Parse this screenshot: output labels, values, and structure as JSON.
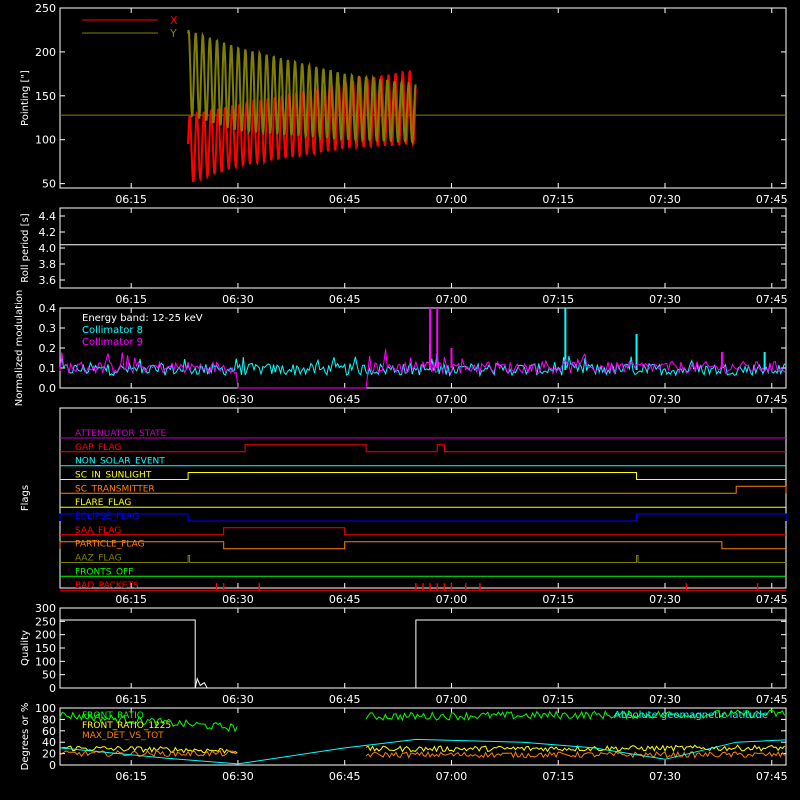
{
  "colors": {
    "background": "#000000",
    "axis": "#ffffff",
    "red": "#ff0000",
    "olive": "#808000",
    "cyan": "#00ffff",
    "magenta": "#ff00ff",
    "green": "#00ff00",
    "orange": "#ff8000",
    "yellow": "#ffff00",
    "blue": "#0000ff",
    "purple": "#c000c0"
  },
  "chart_data": [
    {
      "type": "line",
      "ylabel": "Pointing [\"]",
      "xlim": [
        "06:05",
        "07:47"
      ],
      "ylim": [
        45,
        250
      ],
      "x_ticks": [
        "06:15",
        "06:30",
        "06:45",
        "07:00",
        "07:15",
        "07:30",
        "07:45"
      ],
      "y_ticks": [
        50,
        100,
        150,
        200,
        250
      ],
      "reference_line": 128,
      "legend": [
        "X",
        "Y"
      ],
      "series": [
        {
          "name": "X",
          "color": "#ff0000",
          "envelope": [
            {
              "t": "06:23",
              "min": 50,
              "max": 128
            },
            {
              "t": "06:30",
              "min": 70,
              "max": 140
            },
            {
              "t": "06:45",
              "min": 90,
              "max": 165
            },
            {
              "t": "06:55",
              "min": 95,
              "max": 180
            }
          ]
        },
        {
          "name": "Y",
          "color": "#808000",
          "envelope": [
            {
              "t": "06:23",
              "min": 128,
              "max": 225
            },
            {
              "t": "06:30",
              "min": 110,
              "max": 205
            },
            {
              "t": "06:45",
              "min": 100,
              "max": 175
            },
            {
              "t": "06:55",
              "min": 97,
              "max": 163
            }
          ]
        }
      ]
    },
    {
      "type": "line",
      "ylabel": "Roll period [s]",
      "xlim": [
        "06:05",
        "07:47"
      ],
      "ylim": [
        3.5,
        4.5
      ],
      "x_ticks": [
        "06:15",
        "06:30",
        "06:45",
        "07:00",
        "07:15",
        "07:30",
        "07:45"
      ],
      "y_ticks": [
        "3.6",
        "3.8",
        "4.0",
        "4.2",
        "4.4"
      ],
      "series": [
        {
          "name": "",
          "color": "#ffffff",
          "x": [
            "06:05",
            "07:47"
          ],
          "y": [
            4.04,
            4.04
          ]
        }
      ]
    },
    {
      "type": "line",
      "ylabel": "Normalized modulation",
      "ylim": [
        0,
        0.4
      ],
      "y_ticks": [
        "0.0",
        "0.1",
        "0.2",
        "0.3",
        "0.4"
      ],
      "x_ticks": [
        "06:15",
        "06:30",
        "06:45",
        "07:00",
        "07:15",
        "07:30",
        "07:45"
      ],
      "legend_title": "Energy band: 12-25 keV",
      "series": [
        {
          "name": "Collimator 8",
          "color": "#00ffff",
          "baseline": 0.09,
          "spikes": [
            {
              "t": "06:57",
              "y": 0.22
            },
            {
              "t": "07:16",
              "y": 0.4
            },
            {
              "t": "07:26",
              "y": 0.27
            },
            {
              "t": "07:44",
              "y": 0.18
            }
          ]
        },
        {
          "name": "Collimator 9",
          "color": "#ff00ff",
          "baseline": 0.1,
          "gap": [
            "06:30",
            "06:48"
          ],
          "spikes": [
            {
              "t": "06:57",
              "y": 0.4
            },
            {
              "t": "06:58",
              "y": 0.4
            },
            {
              "t": "07:00",
              "y": 0.2
            },
            {
              "t": "07:38",
              "y": 0.18
            }
          ]
        }
      ]
    },
    {
      "type": "line",
      "ylabel": "Flags",
      "x_ticks": [
        "06:15",
        "06:30",
        "06:45",
        "07:00",
        "07:15",
        "07:30",
        "07:45"
      ],
      "flags": [
        {
          "name": "ATTENUATOR_STATE",
          "color": "#c000c0",
          "highs": []
        },
        {
          "name": "GAP_FLAG",
          "color": "#ff0000",
          "highs": [
            [
              "06:31",
              "06:48"
            ],
            [
              "06:58",
              "06:59"
            ]
          ]
        },
        {
          "name": "NON_SOLAR_EVENT",
          "color": "#00ffff",
          "highs": []
        },
        {
          "name": "SC_IN_SUNLIGHT",
          "color": "#ffff00",
          "highs": [
            [
              "06:23",
              "07:26"
            ]
          ]
        },
        {
          "name": "SC_TRANSMITTER",
          "color": "#ff8000",
          "highs": [
            [
              "07:40",
              "07:47"
            ]
          ]
        },
        {
          "name": "FLARE_FLAG",
          "color": "#ffff00",
          "highs": []
        },
        {
          "name": "ECLIPSE_FLAG",
          "color": "#0000ff",
          "highs": [
            [
              "06:05",
              "06:23"
            ],
            [
              "07:26",
              "07:47"
            ]
          ]
        },
        {
          "name": "SAA_FLAG",
          "color": "#ff0000",
          "highs": [
            [
              "06:28",
              "06:45"
            ]
          ]
        },
        {
          "name": "PARTICLE_FLAG",
          "color": "#ff8000",
          "highs": [
            [
              "06:05",
              "06:28"
            ],
            [
              "06:45",
              "07:38"
            ]
          ]
        },
        {
          "name": "AAZ_FLAG",
          "color": "#808000",
          "highs": [
            [
              "06:23",
              "06:23"
            ],
            [
              "07:26",
              "07:26"
            ]
          ]
        },
        {
          "name": "FRONTS_OFF",
          "color": "#00ff00",
          "highs": []
        },
        {
          "name": "BAD_PACKETS",
          "color": "#ff0000",
          "highs": []
        }
      ]
    },
    {
      "type": "line",
      "ylabel": "Quality",
      "xlim": [
        "06:05",
        "07:47"
      ],
      "ylim": [
        0,
        300
      ],
      "x_ticks": [
        "06:15",
        "06:30",
        "06:45",
        "07:00",
        "07:15",
        "07:30",
        "07:45"
      ],
      "y_ticks": [
        0,
        50,
        100,
        150,
        200,
        250,
        300
      ],
      "series": [
        {
          "name": "",
          "color": "#ffffff",
          "x": [
            "06:05",
            "06:24",
            "06:24",
            "06:55",
            "06:55",
            "07:47"
          ],
          "y": [
            255,
            255,
            0,
            0,
            255,
            255
          ]
        }
      ]
    },
    {
      "type": "line",
      "ylabel": "Degrees or %",
      "xlim": [
        "06:05",
        "07:47"
      ],
      "ylim": [
        0,
        100
      ],
      "x_ticks": [
        "06:15",
        "06:30",
        "06:45",
        "07:00",
        "07:15",
        "07:30",
        "07:45"
      ],
      "y_ticks": [
        0,
        20,
        40,
        60,
        80,
        100
      ],
      "legend_right": "Absolute geomagnetic latitude",
      "series": [
        {
          "name": "FRONT_RATIO",
          "color": "#00ff00",
          "segments": [
            [
              "06:05",
              "06:30",
              88,
              65
            ],
            [
              "06:48",
              "07:47",
              85,
              90
            ]
          ]
        },
        {
          "name": "FRONT_RATIO_1225",
          "color": "#ffff00",
          "segments": [
            [
              "06:05",
              "06:30",
              30,
              25
            ],
            [
              "06:48",
              "07:47",
              28,
              30
            ]
          ]
        },
        {
          "name": "MAX_DET_VS_TOT",
          "color": "#ff8000",
          "segments": [
            [
              "06:05",
              "06:30",
              20,
              20
            ],
            [
              "06:48",
              "07:47",
              18,
              18
            ]
          ]
        },
        {
          "name": "Absolute geomagnetic latitude",
          "color": "#00ffff",
          "x": [
            "06:05",
            "06:20",
            "06:30",
            "06:45",
            "06:55",
            "07:10",
            "07:20",
            "07:30",
            "07:40",
            "07:47"
          ],
          "y": [
            30,
            12,
            2,
            30,
            45,
            40,
            30,
            10,
            40,
            44
          ]
        }
      ]
    }
  ]
}
